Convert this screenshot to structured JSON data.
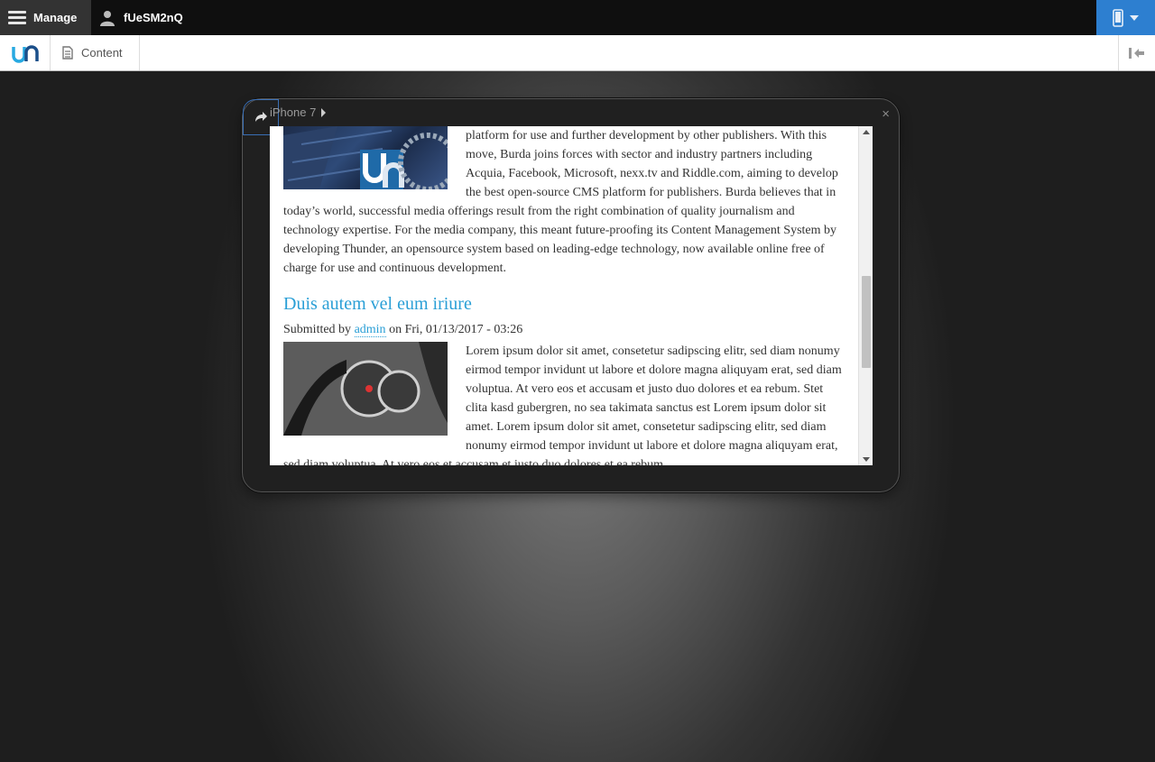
{
  "toolbar": {
    "manage_label": "Manage",
    "user_label": "fUeSM2nQ"
  },
  "tray": {
    "content_label": "Content"
  },
  "device": {
    "name": "iPhone 7",
    "close": "×"
  },
  "article1": {
    "body_tail": "platform for use and further development by other publishers. With this move, Burda joins forces with sector and industry partners including Acquia, Facebook, Microsoft, nexx.tv and Riddle.com, aiming to develop the best open-source CMS platform for publishers. Burda believes that in today’s world, successful media offerings result from the right combination of quality journalism and technology expertise. For the media company, this meant future-proofing its Content Management System by developing Thunder, an opensource system based on leading-edge technology, now available online free of charge for use and continuous development."
  },
  "article2": {
    "title": "Duis autem vel eum iriure",
    "submitted_by": "Submitted by ",
    "author": "admin",
    "date": " on Fri, 01/13/2017 - 03:26",
    "body": "Lorem ipsum dolor sit amet, consetetur sadipscing elitr, sed diam nonumy eirmod tempor invidunt ut labore et dolore magna aliquyam erat, sed diam voluptua. At vero eos et accusam et justo duo dolores et ea rebum. Stet clita kasd gubergren, no sea takimata sanctus est Lorem ipsum dolor sit amet. Lorem ipsum dolor sit amet, consetetur sadipscing elitr, sed diam nonumy eirmod tempor invidunt ut labore et dolore magna aliquyam erat, sed diam voluptua. At vero eos et accusam et justo duo dolores et ea rebum."
  },
  "colors": {
    "accent": "#2a9fd6",
    "device_button": "#2d7fd0"
  }
}
